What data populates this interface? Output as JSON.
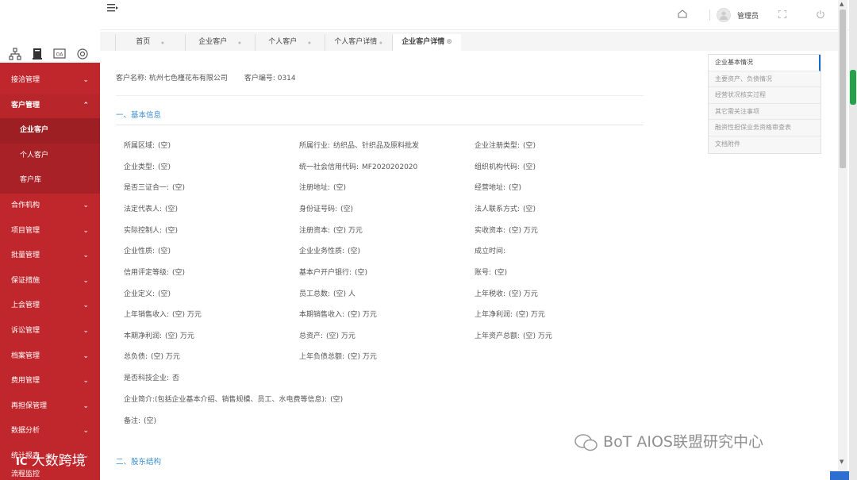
{
  "header": {
    "user_label": "管理员",
    "home_icon": "home-icon",
    "avatar_icon": "avatar-icon",
    "fullscreen_icon": "fullscreen-icon",
    "power_icon": "power-icon"
  },
  "sidebar": {
    "top_icons": [
      "org-chart-icon",
      "book-icon",
      "oa-icon",
      "settings-icon"
    ],
    "oa_text": "OA",
    "items": [
      {
        "label": "接洽管理",
        "chevron": "⌄"
      },
      {
        "label": "客户管理",
        "chevron": "⌃"
      },
      {
        "label": "企业客户"
      },
      {
        "label": "个人客户"
      },
      {
        "label": "客户库"
      },
      {
        "label": "合作机构",
        "chevron": "⌄"
      },
      {
        "label": "项目管理",
        "chevron": "⌄"
      },
      {
        "label": "批量管理",
        "chevron": "⌄"
      },
      {
        "label": "保证措施",
        "chevron": "⌄"
      },
      {
        "label": "上会管理",
        "chevron": "⌄"
      },
      {
        "label": "诉讼管理",
        "chevron": "⌄"
      },
      {
        "label": "档案管理",
        "chevron": "⌄"
      },
      {
        "label": "费用管理",
        "chevron": "⌄"
      },
      {
        "label": "再担保管理",
        "chevron": "⌄"
      },
      {
        "label": "数据分析",
        "chevron": "⌄"
      },
      {
        "label": "统计报表",
        "chevron": "⌄"
      }
    ],
    "bottom_logo": "大数跨境",
    "bottom_logo_prefix": "IC",
    "bottom_partial": "流程监控"
  },
  "tabs": [
    {
      "label": "首页",
      "close": "●"
    },
    {
      "label": "企业客户",
      "close": "●"
    },
    {
      "label": "个人客户",
      "close": "●"
    },
    {
      "label": "个人客户详情",
      "close": "●"
    },
    {
      "label": "企业客户详情",
      "close": "⊗"
    }
  ],
  "customer": {
    "name_label": "客户名称:",
    "name_value": "杭州七色槿花布有限公司",
    "code_label": "客户编号:",
    "code_value": "0314"
  },
  "section1_title": "一、基本信息",
  "section2_title": "二、股东结构",
  "fields": [
    [
      "所属区域:",
      "(空)"
    ],
    [
      "所属行业:",
      "纺织品、针织品及原料批发"
    ],
    [
      "企业注册类型:",
      "(空)"
    ],
    [
      "企业类型:",
      "(空)"
    ],
    [
      "统一社会信用代码:",
      "MF2020202020"
    ],
    [
      "组织机构代码:",
      "(空)"
    ],
    [
      "是否三证合一:",
      "(空)"
    ],
    [
      "注册地址:",
      "(空)"
    ],
    [
      "经营地址:",
      "(空)"
    ],
    [
      "法定代表人:",
      "(空)"
    ],
    [
      "身份证号码:",
      "(空)"
    ],
    [
      "法人联系方式:",
      "(空)"
    ],
    [
      "实际控制人:",
      "(空)"
    ],
    [
      "注册资本:",
      "(空) 万元"
    ],
    [
      "实收资本:",
      "(空) 万元"
    ],
    [
      "企业性质:",
      "(空)"
    ],
    [
      "企业业务性质:",
      "(空)"
    ],
    [
      "成立时间:",
      ""
    ],
    [
      "信用评定等级:",
      "(空)"
    ],
    [
      "基本户开户银行:",
      "(空)"
    ],
    [
      "账号:",
      "(空)"
    ],
    [
      "企业定义:",
      "(空)"
    ],
    [
      "员工总数:",
      "(空) 人"
    ],
    [
      "上年税收:",
      "(空) 万元"
    ],
    [
      "上年销售收入:",
      "(空) 万元"
    ],
    [
      "本期销售收入:",
      "(空) 万元"
    ],
    [
      "上年净利润:",
      "(空) 万元"
    ],
    [
      "本期净利润:",
      "(空) 万元"
    ],
    [
      "总资产:",
      "(空) 万元"
    ],
    [
      "上年资产总额:",
      "(空) 万元"
    ],
    [
      "总负债:",
      "(空) 万元"
    ],
    [
      "上年负债总额:",
      "(空) 万元"
    ],
    [
      "是否科技企业:",
      "否"
    ],
    [
      "企业简介:(包括企业基本介绍、销售规模、员工、水电费等信息):",
      "(空)"
    ],
    [
      "备注:",
      "(空)"
    ]
  ],
  "right_nav": [
    "企业基本情况",
    "主要资产、负债情况",
    "经营状况核实过程",
    "其它需关注事项",
    "融资性担保业务资格审查表",
    "文档附件"
  ],
  "watermark": "BoT AIOS联盟研究中心",
  "colors": {
    "sidebar_bg": "#c0272d",
    "accent_blue": "#3e8ed0",
    "active_tab": "#ffffff"
  }
}
